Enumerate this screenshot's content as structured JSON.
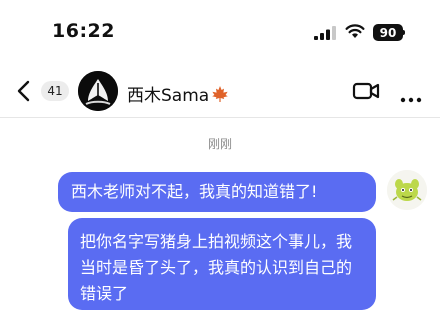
{
  "status_bar": {
    "time": "16:22",
    "battery": "90"
  },
  "header": {
    "unread_count": "41",
    "contact_name": "西木Sama",
    "name_emoji": "leaf-icon"
  },
  "messages": {
    "timestamp": "刚刚",
    "items": [
      {
        "text": "西木老师对不起，我真的知道错了!",
        "sender": "me"
      },
      {
        "text": "把你名字写猪身上拍视频这个事儿，我当时是昏了头了，我真的认识到自己的错误了",
        "sender": "me"
      }
    ]
  },
  "colors": {
    "bubble": "#5a6cf2",
    "leaf": "#e0632a",
    "badge_bg": "#ececec"
  }
}
